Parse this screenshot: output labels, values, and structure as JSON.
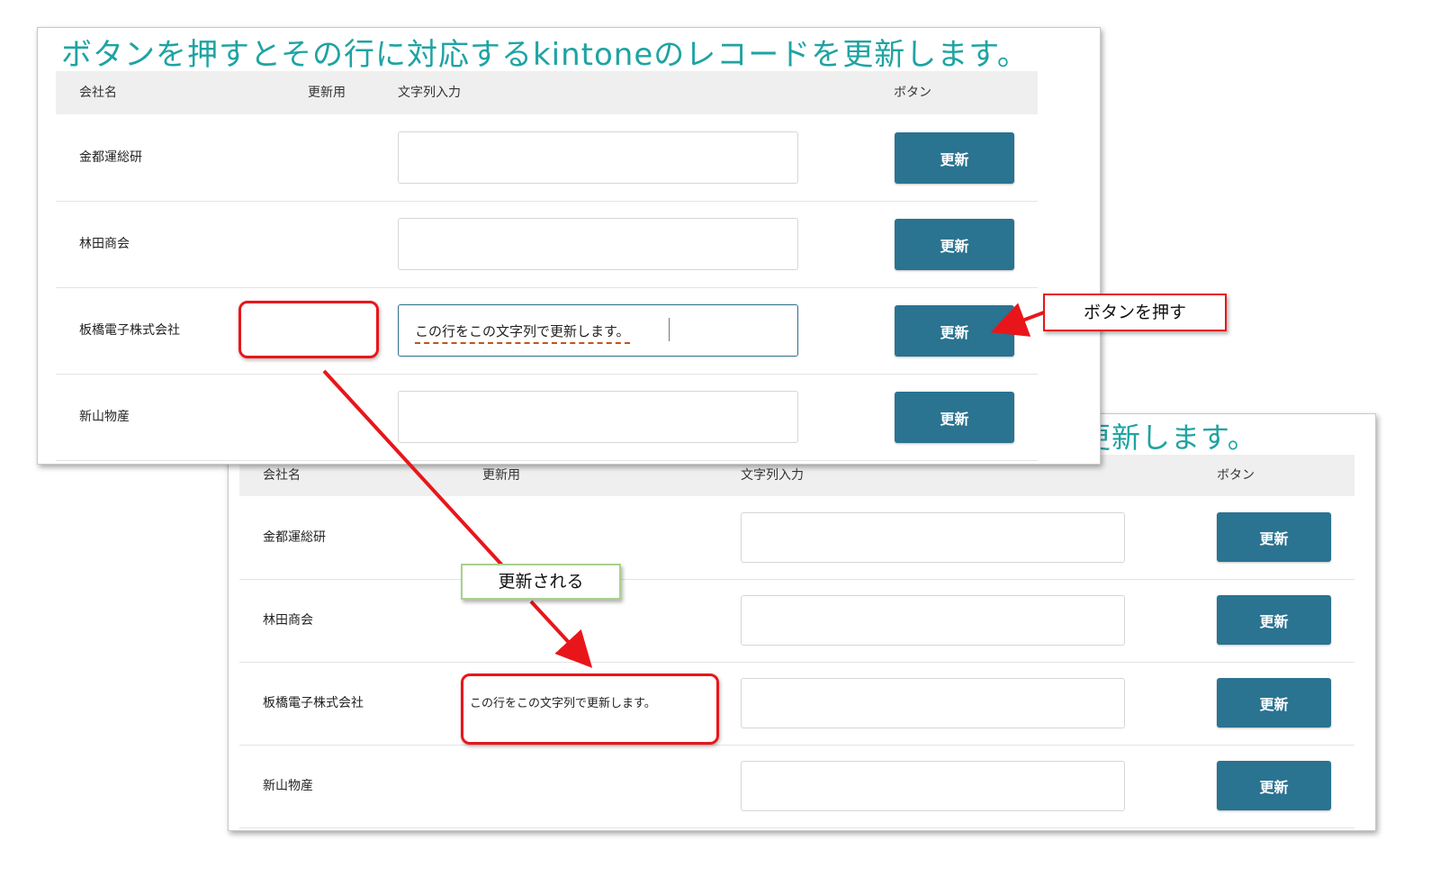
{
  "top_panel": {
    "title": "ボタンを押すとその行に対応するkintoneのレコードを更新します。",
    "headers": {
      "company": "会社名",
      "update_field": "更新用",
      "text_input": "文字列入力",
      "button": "ボタン"
    },
    "rows": [
      {
        "company": "金都運総研",
        "input_value": "",
        "button_label": "更新"
      },
      {
        "company": "林田商会",
        "input_value": "",
        "button_label": "更新"
      },
      {
        "company": "板橋電子株式会社",
        "input_value": "この行をこの文字列で更新します。",
        "button_label": "更新"
      },
      {
        "company": "新山物産",
        "input_value": "",
        "button_label": "更新"
      }
    ]
  },
  "bottom_panel": {
    "title_fragment": "更新します。",
    "headers": {
      "company": "会社名",
      "update_field": "更新用",
      "text_input": "文字列入力",
      "button": "ボタン"
    },
    "rows": [
      {
        "company": "金都運総研",
        "updated_value": "",
        "button_label": "更新"
      },
      {
        "company": "林田商会",
        "updated_value": "",
        "button_label": "更新"
      },
      {
        "company": "板橋電子株式会社",
        "updated_value": "この行をこの文字列で更新します。",
        "button_label": "更新"
      },
      {
        "company": "新山物産",
        "updated_value": "",
        "button_label": "更新"
      }
    ]
  },
  "annotations": {
    "press_button": "ボタンを押す",
    "gets_updated": "更新される"
  },
  "colors": {
    "title": "#1fa3a3",
    "button": "#2a7391",
    "annotation_red": "#e8161b",
    "annotation_green": "#a9d18e",
    "header_bg": "#efefef"
  }
}
